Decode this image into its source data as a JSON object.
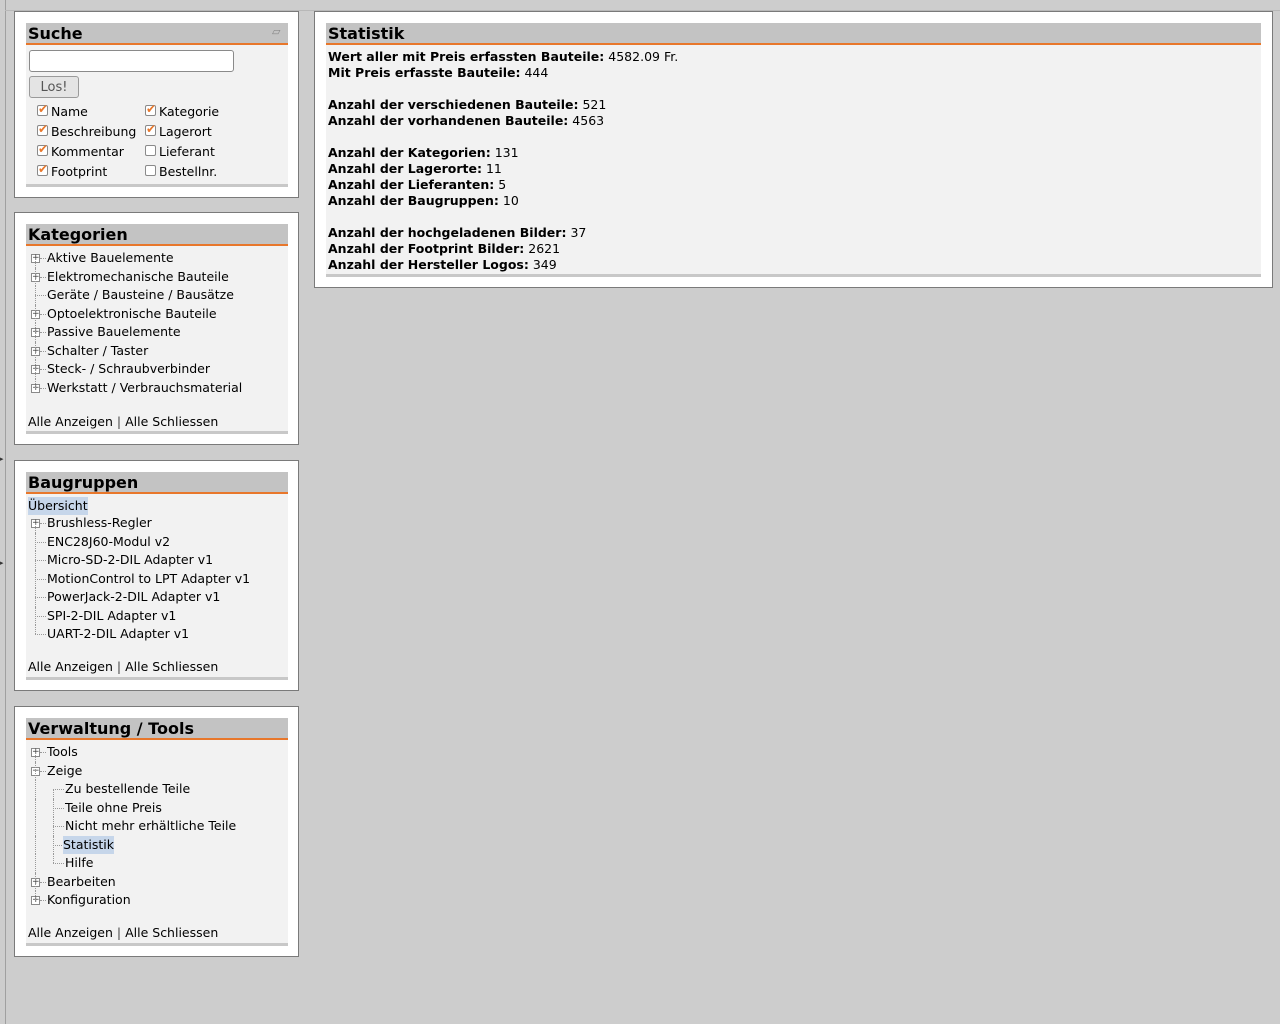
{
  "search": {
    "title": "Suche",
    "input_value": "",
    "button_label": "Los!",
    "options": [
      {
        "label": "Name",
        "checked": true
      },
      {
        "label": "Kategorie",
        "checked": true
      },
      {
        "label": "Beschreibung",
        "checked": true
      },
      {
        "label": "Lagerort",
        "checked": true
      },
      {
        "label": "Kommentar",
        "checked": true
      },
      {
        "label": "Lieferant",
        "checked": false
      },
      {
        "label": "Footprint",
        "checked": true
      },
      {
        "label": "Bestellnr.",
        "checked": false
      }
    ]
  },
  "categories": {
    "title": "Kategorien",
    "items": [
      "Aktive Bauelemente",
      "Elektromechanische Bauteile",
      "Geräte / Bausteine / Bausätze",
      "Optoelektronische Bauteile",
      "Passive Bauelemente",
      "Schalter / Taster",
      "Steck- / Schraubverbinder",
      "Werkstatt / Verbrauchsmaterial"
    ],
    "show_all": "Alle Anzeigen",
    "separator": "|",
    "close_all": "Alle Schliessen"
  },
  "assemblies": {
    "title": "Baugruppen",
    "overview": "Übersicht",
    "items": [
      "Brushless-Regler",
      "ENC28J60-Modul v2",
      "Micro-SD-2-DIL Adapter v1",
      "MotionControl to LPT Adapter v1",
      "PowerJack-2-DIL Adapter v1",
      "SPI-2-DIL Adapter v1",
      "UART-2-DIL Adapter v1"
    ],
    "show_all": "Alle Anzeigen",
    "separator": "|",
    "close_all": "Alle Schliessen"
  },
  "tools": {
    "title": "Verwaltung / Tools",
    "items": {
      "tools": "Tools",
      "zeige": "Zeige",
      "zeige_children": [
        "Zu bestellende Teile",
        "Teile ohne Preis",
        "Nicht mehr erhältliche Teile",
        "Statistik",
        "Hilfe"
      ],
      "bearbeiten": "Bearbeiten",
      "konfiguration": "Konfiguration"
    },
    "show_all": "Alle Anzeigen",
    "separator": "|",
    "close_all": "Alle Schliessen"
  },
  "statistics": {
    "title": "Statistik",
    "rows": [
      {
        "label": "Wert aller mit Preis erfassten Bauteile:",
        "value": "4582.09 Fr."
      },
      {
        "label": "Mit Preis erfasste Bauteile:",
        "value": "444"
      },
      {
        "label": "Anzahl der verschiedenen Bauteile:",
        "value": "521"
      },
      {
        "label": "Anzahl der vorhandenen Bauteile:",
        "value": "4563"
      },
      {
        "label": "Anzahl der Kategorien:",
        "value": "131"
      },
      {
        "label": "Anzahl der Lagerorte:",
        "value": "11"
      },
      {
        "label": "Anzahl der Lieferanten:",
        "value": "5"
      },
      {
        "label": "Anzahl der Baugruppen:",
        "value": "10"
      },
      {
        "label": "Anzahl der hochgeladenen Bilder:",
        "value": "37"
      },
      {
        "label": "Anzahl der Footprint Bilder:",
        "value": "2621"
      },
      {
        "label": "Anzahl der Hersteller Logos:",
        "value": "349"
      }
    ]
  },
  "colors": {
    "accent": "#e8772b",
    "header_bg": "#c3c3c3",
    "panel_bg": "#f2f2f2",
    "page_bg": "#cdcdcd",
    "selection": "#c6d6ea"
  }
}
